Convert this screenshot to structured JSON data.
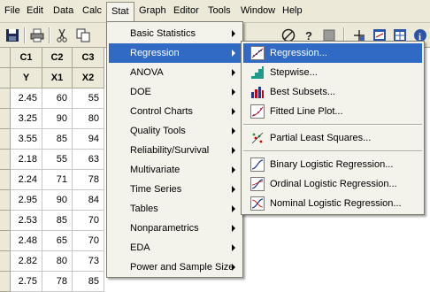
{
  "menubar": {
    "items": [
      {
        "label": "File"
      },
      {
        "label": "Edit"
      },
      {
        "label": "Data"
      },
      {
        "label": "Calc"
      },
      {
        "label": "Stat"
      },
      {
        "label": "Graph"
      },
      {
        "label": "Editor"
      },
      {
        "label": "Tools"
      },
      {
        "label": "Window"
      },
      {
        "label": "Help"
      }
    ],
    "active": "Stat"
  },
  "toolbar": {
    "icons": [
      "save-icon",
      "print-icon",
      "cut-icon",
      "copy-icon",
      "stop-icon",
      "help-icon",
      "layout-icon",
      "graph-icon",
      "info-icon"
    ]
  },
  "worksheet": {
    "columns": [
      {
        "id": "C1",
        "name": "Y"
      },
      {
        "id": "C2",
        "name": "X1"
      },
      {
        "id": "C3",
        "name": "X2"
      }
    ],
    "rows": [
      [
        "2.45",
        "60",
        "55"
      ],
      [
        "3.25",
        "90",
        "80"
      ],
      [
        "3.55",
        "85",
        "94"
      ],
      [
        "2.18",
        "55",
        "63"
      ],
      [
        "2.24",
        "71",
        "78"
      ],
      [
        "2.95",
        "90",
        "84"
      ],
      [
        "2.53",
        "85",
        "70"
      ],
      [
        "2.48",
        "65",
        "70"
      ],
      [
        "2.82",
        "80",
        "73"
      ],
      [
        "2.75",
        "78",
        "85"
      ]
    ]
  },
  "stat_menu": {
    "items": [
      {
        "label": "Basic Statistics",
        "submenu": true
      },
      {
        "label": "Regression",
        "submenu": true,
        "highlighted": true
      },
      {
        "label": "ANOVA",
        "submenu": true
      },
      {
        "label": "DOE",
        "submenu": true
      },
      {
        "label": "Control Charts",
        "submenu": true
      },
      {
        "label": "Quality Tools",
        "submenu": true
      },
      {
        "label": "Reliability/Survival",
        "submenu": true
      },
      {
        "label": "Multivariate",
        "submenu": true
      },
      {
        "label": "Time Series",
        "submenu": true
      },
      {
        "label": "Tables",
        "submenu": true
      },
      {
        "label": "Nonparametrics",
        "submenu": true
      },
      {
        "label": "EDA",
        "submenu": true
      },
      {
        "label": "Power and Sample Size",
        "submenu": true
      }
    ]
  },
  "regression_menu": {
    "items": [
      {
        "label": "Regression...",
        "icon": "regression-icon",
        "highlighted": true
      },
      {
        "label": "Stepwise...",
        "icon": "stepwise-icon"
      },
      {
        "label": "Best Subsets...",
        "icon": "best-subsets-icon"
      },
      {
        "label": "Fitted Line Plot...",
        "icon": "fitted-line-plot-icon"
      },
      {
        "label": "Partial Least Squares...",
        "icon": "pls-icon"
      },
      {
        "label": "Binary Logistic Regression...",
        "icon": "binary-logistic-icon"
      },
      {
        "label": "Ordinal Logistic Regression...",
        "icon": "ordinal-logistic-icon"
      },
      {
        "label": "Nominal Logistic Regression...",
        "icon": "nominal-logistic-icon"
      }
    ]
  },
  "colors": {
    "highlight": "#316ac5",
    "menu_bg": "#f3f2eb",
    "chrome": "#ece9d8"
  }
}
